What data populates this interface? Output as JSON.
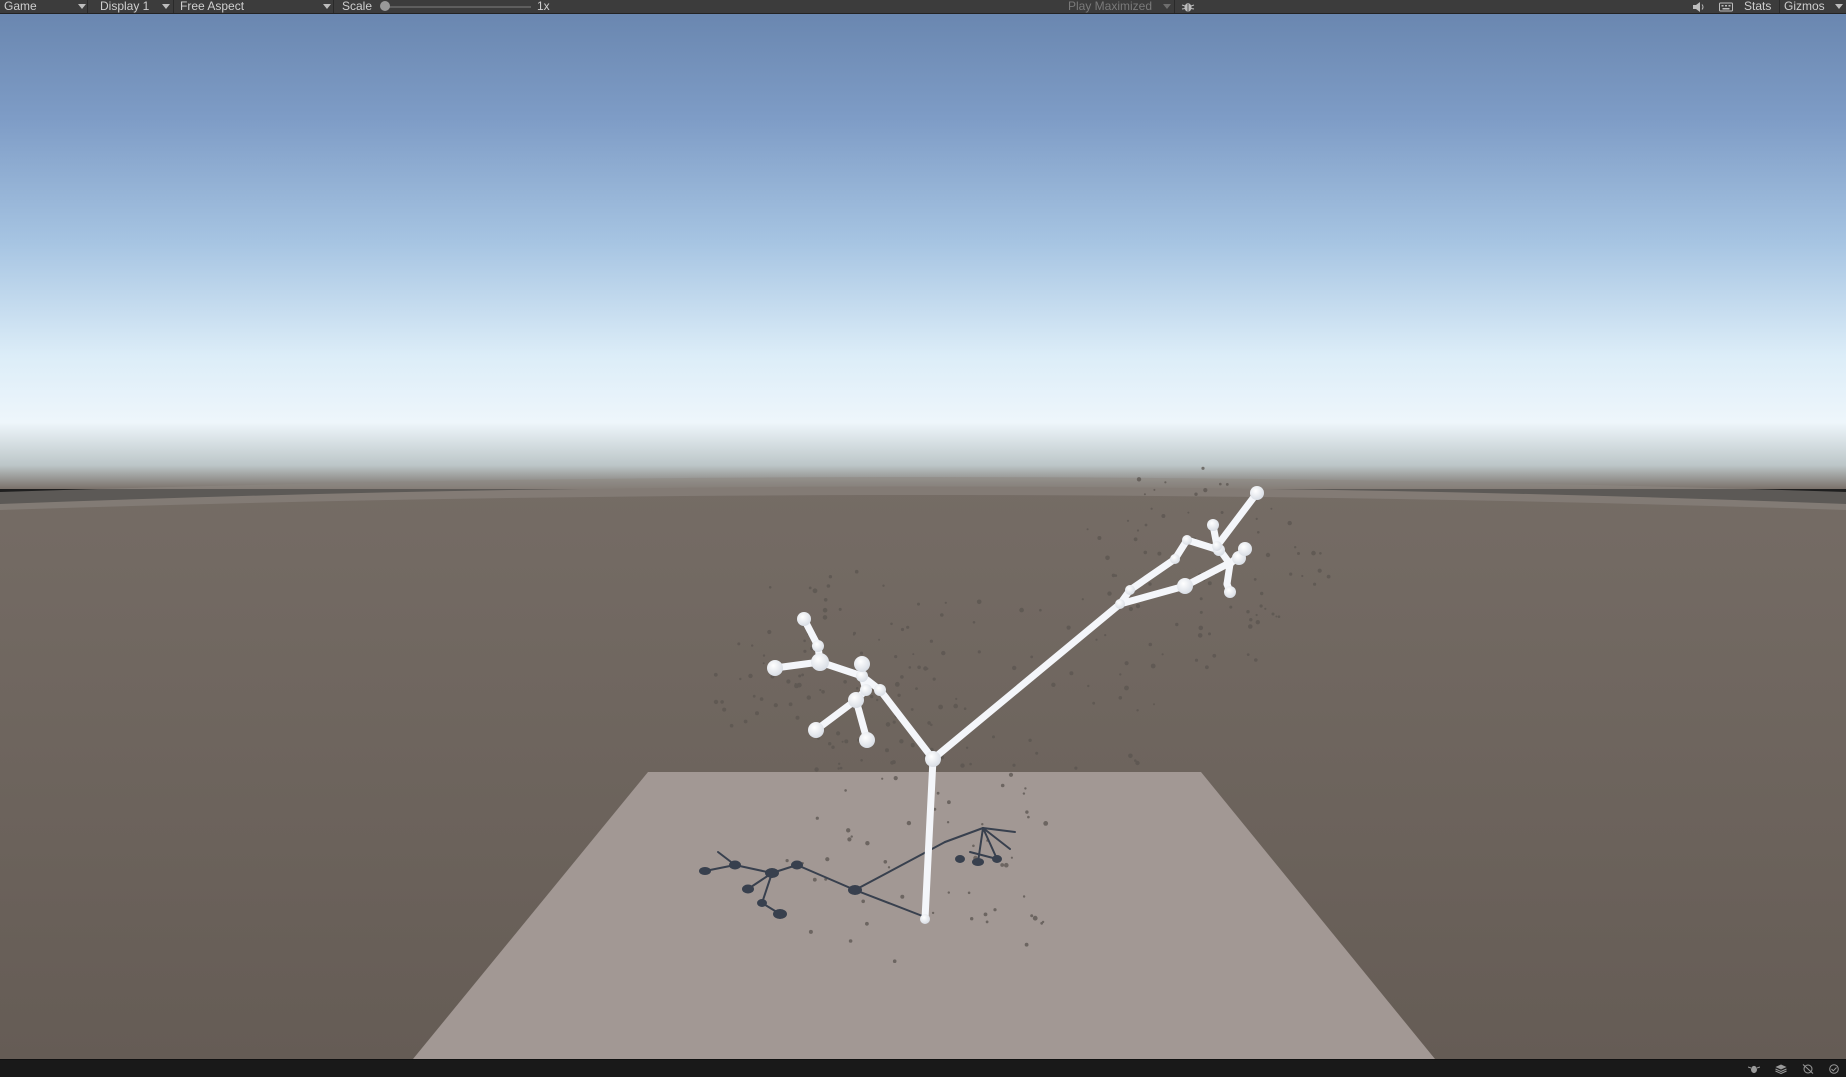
{
  "toolbar": {
    "view_mode": "Game",
    "display": "Display 1",
    "aspect": "Free Aspect",
    "scale_label": "Scale",
    "scale_value": "1x",
    "scale_fraction": 0.0,
    "play_mode": "Play Maximized",
    "stats_label": "Stats",
    "gizmos_label": "Gizmos"
  },
  "icons": {
    "view_mode": "chevron-down-icon",
    "debug": "bug-icon",
    "audio": "speaker-icon",
    "keyboard": "keyboard-icon",
    "status": [
      "bug-icon",
      "stack-icon",
      "network-icon",
      "check-circle-icon"
    ]
  },
  "colors": {
    "toolbar_bg": "#3c3c3c",
    "sky_top": "#6a87b0",
    "horizon": "#eef6fb",
    "ground": "#6b625b",
    "plane": "#a29894",
    "shadow": "#38404e",
    "creature": "#ffffff",
    "statusbar_bg": "#191919"
  }
}
